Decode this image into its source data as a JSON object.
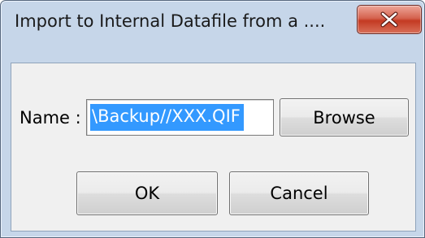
{
  "dialog": {
    "title": "Import to Internal Datafile from a ....",
    "close_icon": "close-x-icon",
    "close_color": "#c43a22"
  },
  "form": {
    "name_label": "Name :",
    "name_value": "\\Backup//XXX.QIF",
    "browse_label": "Browse"
  },
  "actions": {
    "ok_label": "OK",
    "cancel_label": "Cancel"
  },
  "colors": {
    "selection": "#3399ff",
    "frame": "#c6d6e9",
    "client": "#f0f0f0"
  }
}
